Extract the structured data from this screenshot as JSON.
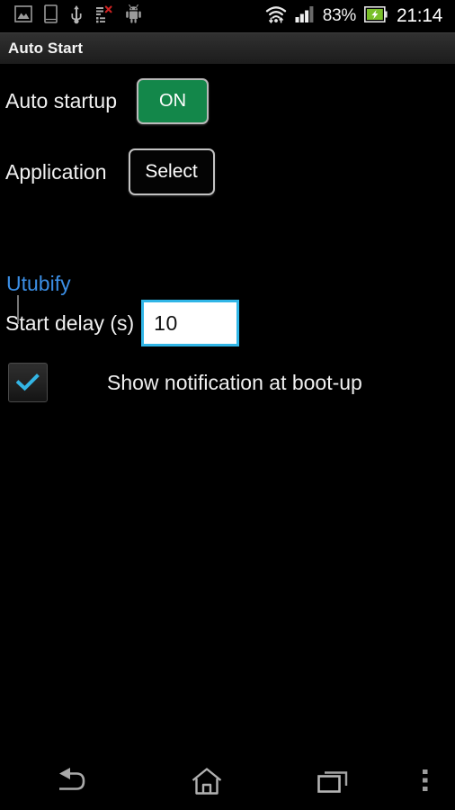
{
  "status_bar": {
    "left_icons": [
      {
        "name": "screenshot-icon",
        "label": "screenshot"
      },
      {
        "name": "device-icon",
        "label": "device"
      },
      {
        "name": "usb-icon",
        "label": "usb"
      },
      {
        "name": "sync-error-icon",
        "label": "sync-error"
      },
      {
        "name": "android-icon",
        "label": "android"
      }
    ],
    "right_icons": [
      {
        "name": "wifi-icon",
        "label": "wifi"
      },
      {
        "name": "signal-icon",
        "label": "signal"
      },
      {
        "name": "battery-charging-icon",
        "label": "battery-charging"
      }
    ],
    "battery_percent": "83%",
    "clock": "21:14"
  },
  "title_bar": {
    "title": "Auto Start"
  },
  "settings": {
    "auto_startup": {
      "label": "Auto startup",
      "toggle_value": "ON",
      "toggle_color": "#13874a"
    },
    "application": {
      "label": "Application",
      "button_label": "Select",
      "selected_app": "Utubify",
      "selected_app_color": "#3b8ee5"
    },
    "start_delay": {
      "label": "Start delay (s)",
      "value": "10",
      "focus_color": "#31b6e7"
    },
    "notification": {
      "label": "Show notification at boot-up",
      "checked": true,
      "check_color": "#33b5e5"
    }
  },
  "nav_bar": {
    "buttons": [
      {
        "name": "back-icon",
        "label": "Back"
      },
      {
        "name": "home-icon",
        "label": "Home"
      },
      {
        "name": "recents-icon",
        "label": "Recent apps"
      },
      {
        "name": "overflow-menu-icon",
        "label": "More options"
      }
    ]
  }
}
